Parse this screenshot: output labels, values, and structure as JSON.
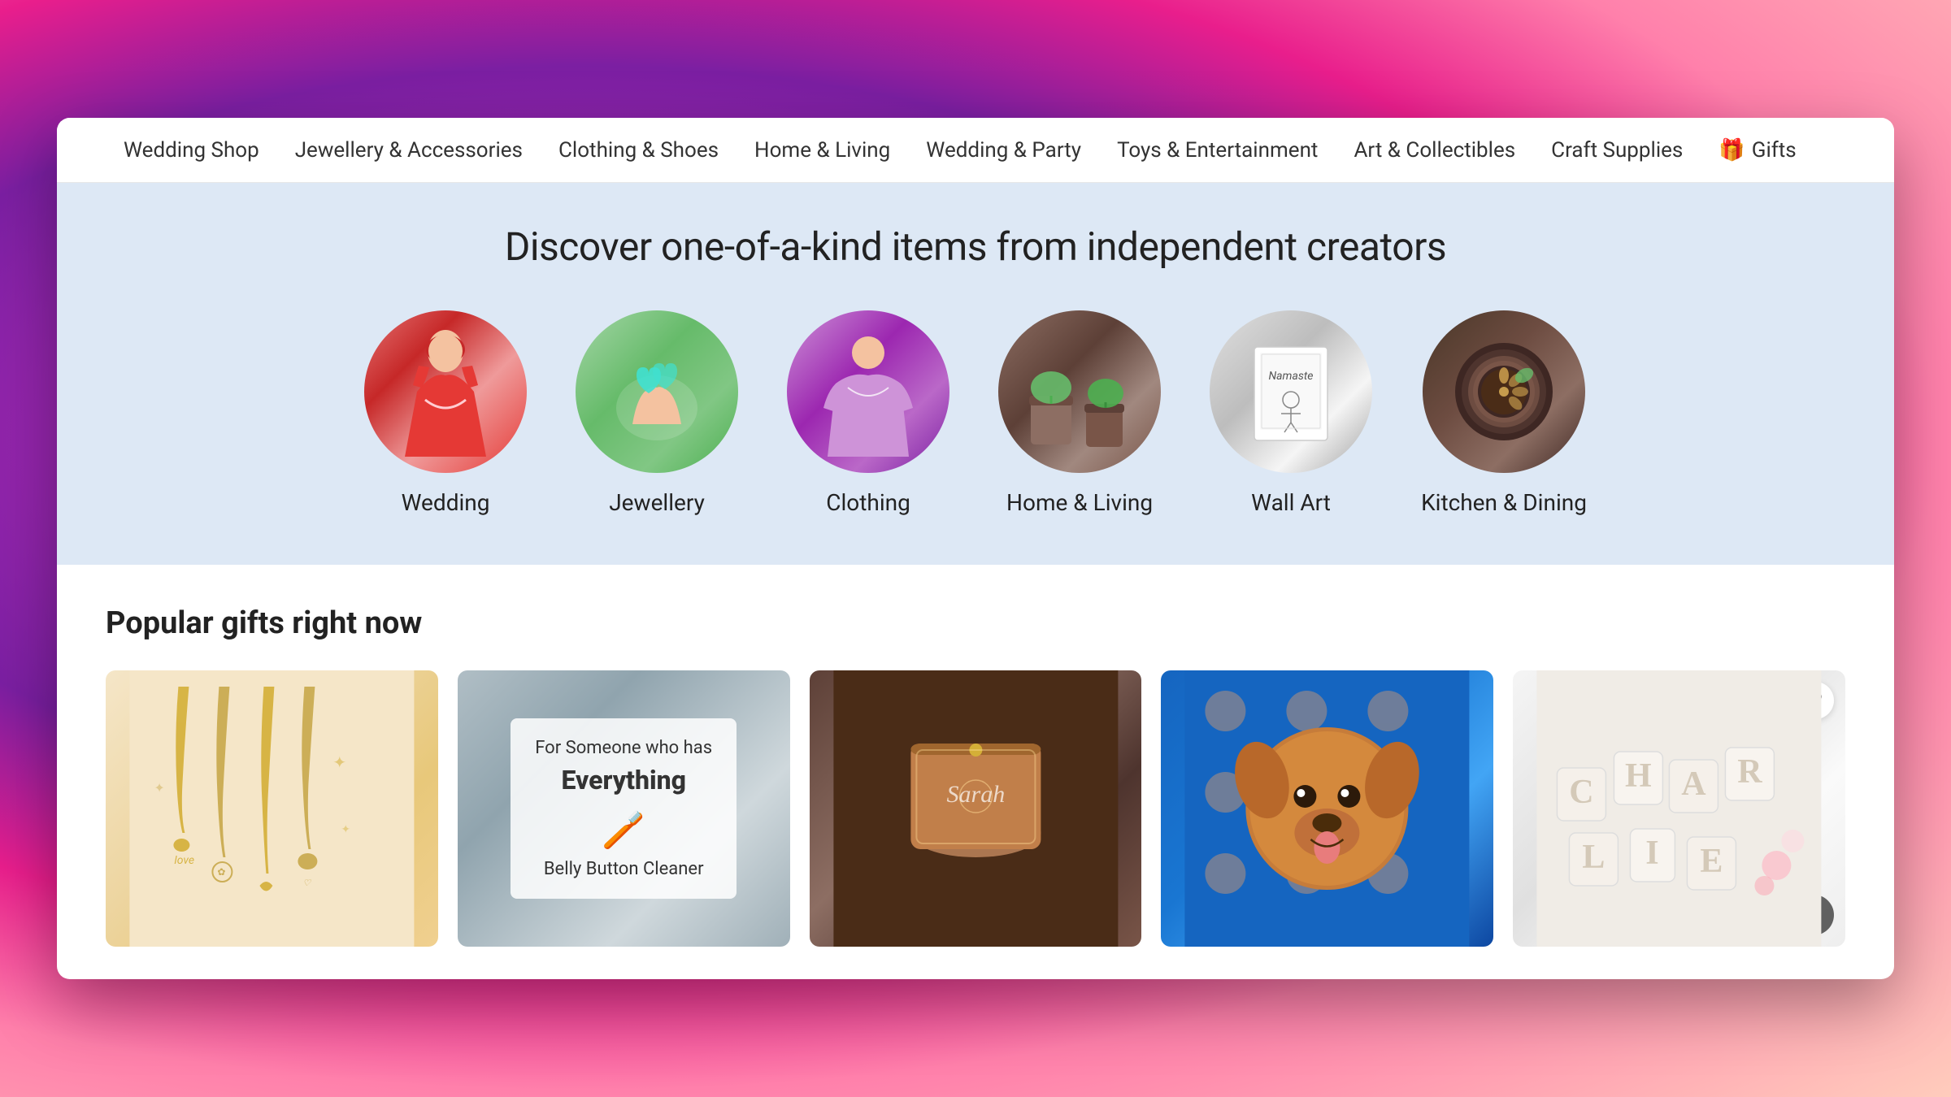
{
  "nav": {
    "items": [
      {
        "id": "wedding-shop",
        "label": "Wedding Shop"
      },
      {
        "id": "jewellery-accessories",
        "label": "Jewellery & Accessories"
      },
      {
        "id": "clothing-shoes",
        "label": "Clothing & Shoes"
      },
      {
        "id": "home-living",
        "label": "Home & Living"
      },
      {
        "id": "wedding-party",
        "label": "Wedding & Party"
      },
      {
        "id": "toys-entertainment",
        "label": "Toys & Entertainment"
      },
      {
        "id": "art-collectibles",
        "label": "Art & Collectibles"
      },
      {
        "id": "craft-supplies",
        "label": "Craft Supplies"
      },
      {
        "id": "gifts",
        "label": "Gifts",
        "has_icon": true
      }
    ]
  },
  "hero": {
    "title": "Discover one-of-a-kind items from independent creators",
    "categories": [
      {
        "id": "wedding",
        "label": "Wedding",
        "emoji": "👰",
        "style": "cat-wedding"
      },
      {
        "id": "jewellery",
        "label": "Jewellery",
        "emoji": "💎",
        "style": "cat-jewellery"
      },
      {
        "id": "clothing",
        "label": "Clothing",
        "emoji": "👗",
        "style": "cat-clothing"
      },
      {
        "id": "home-living",
        "label": "Home & Living",
        "emoji": "🪴",
        "style": "cat-home"
      },
      {
        "id": "wall-art",
        "label": "Wall Art",
        "emoji": "🖼️",
        "style": "cat-wallart"
      },
      {
        "id": "kitchen-dining",
        "label": "Kitchen & Dining",
        "emoji": "☕",
        "style": "cat-kitchen"
      }
    ]
  },
  "popular": {
    "section_title": "Popular gifts right now",
    "products": [
      {
        "id": "product-1",
        "type": "jewellery-chains",
        "alt": "Gold floral name necklaces"
      },
      {
        "id": "product-2",
        "type": "belly-button-cleaner",
        "line1": "For Someone who has",
        "line2": "Everything",
        "line3": "Belly Button Cleaner"
      },
      {
        "id": "product-3",
        "type": "jewelry-box",
        "text": "Sarah"
      },
      {
        "id": "product-4",
        "type": "dog-blanket",
        "alt": "Custom dog face blanket"
      },
      {
        "id": "product-5",
        "type": "name-puzzle",
        "text": "CHARLIE"
      }
    ]
  }
}
